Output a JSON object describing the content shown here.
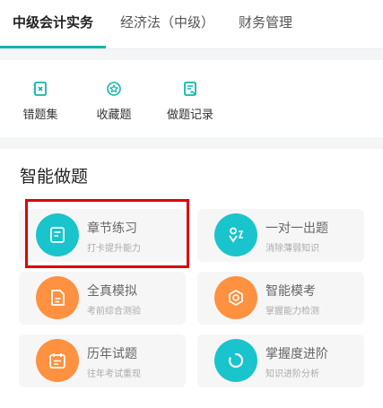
{
  "tabs": [
    "中级会计实务",
    "经济法（中级）",
    "财务管理"
  ],
  "quick_tools": {
    "wrong": "错题集",
    "favorites": "收藏题",
    "history": "做题记录"
  },
  "smart": {
    "title": "智能做题",
    "cards": [
      {
        "title": "章节练习",
        "subtitle": "打卡提升能力"
      },
      {
        "title": "一对一出题",
        "subtitle": "消除薄弱知识"
      },
      {
        "title": "全真模拟",
        "subtitle": "考前综合测验"
      },
      {
        "title": "智能模考",
        "subtitle": "掌握能力检测"
      },
      {
        "title": "历年试题",
        "subtitle": "往年考试重现"
      },
      {
        "title": "掌握度进阶",
        "subtitle": "知识进阶分析"
      }
    ]
  },
  "colors": {
    "accent": "#10b5ad",
    "teal": "#19c4cc",
    "orange": "#ff9140",
    "highlight": "#e00000"
  }
}
